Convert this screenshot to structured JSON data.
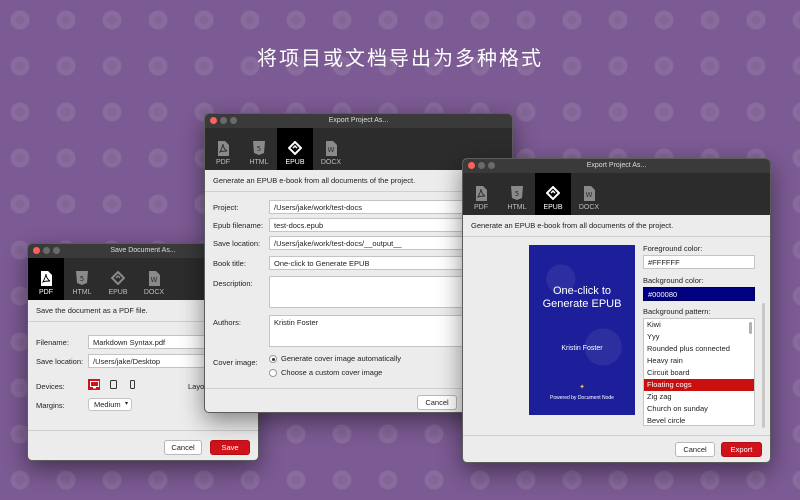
{
  "headline": "将项目或文档导出为多种格式",
  "pdf_window": {
    "title": "Save Document As...",
    "tabs": [
      {
        "label": "PDF",
        "icon": "pdf-file-icon"
      },
      {
        "label": "HTML",
        "icon": "html5-icon"
      },
      {
        "label": "EPUB",
        "icon": "epub-icon"
      },
      {
        "label": "DOCX",
        "icon": "word-doc-icon"
      }
    ],
    "description": "Save the document as a PDF file.",
    "filename_label": "Filename:",
    "filename_value": "Markdown Syntax.pdf",
    "save_location_label": "Save location:",
    "save_location_value": "/Users/jake/Desktop",
    "devices_label": "Devices:",
    "layout_label": "Layo",
    "margins_label": "Margins:",
    "margins_value": "Medium",
    "cancel": "Cancel",
    "save": "Save"
  },
  "epub_window": {
    "title": "Export Project As...",
    "tabs": [
      {
        "label": "PDF"
      },
      {
        "label": "HTML"
      },
      {
        "label": "EPUB"
      },
      {
        "label": "DOCX"
      }
    ],
    "description": "Generate an EPUB e-book from all documents of the project.",
    "project_label": "Project:",
    "project_value": "/Users/jake/work/test-docs",
    "epub_filename_label": "Epub filename:",
    "epub_filename_value": "test-docs.epub",
    "save_location_label": "Save location:",
    "save_location_value": "/Users/jake/work/test-docs/__output__",
    "book_title_label": "Book title:",
    "book_title_value": "One-click to Generate EPUB",
    "description_label": "Description:",
    "authors_label": "Authors:",
    "authors_value": "Kristin Foster",
    "cover_image_label": "Cover image:",
    "cover_option_auto": "Generate cover image automatically",
    "cover_option_custom": "Choose a custom cover image",
    "cancel": "Cancel"
  },
  "cover_window": {
    "title": "Export Project As...",
    "tabs": [
      {
        "label": "PDF"
      },
      {
        "label": "HTML"
      },
      {
        "label": "EPUB"
      },
      {
        "label": "DOCX"
      }
    ],
    "description": "Generate an EPUB e-book from all documents of the project.",
    "cover": {
      "title": "One-click to Generate EPUB",
      "author": "Kristin Foster",
      "powered": "Powered by Document Node"
    },
    "foreground_label": "Foreground color:",
    "foreground_value": "#FFFFFF",
    "background_label": "Background color:",
    "background_value": "#000080",
    "pattern_label": "Background pattern:",
    "patterns": [
      "Kiwi",
      "Yyy",
      "Rounded plus connected",
      "Heavy rain",
      "Circuit board",
      "Floating cogs",
      "Zig zag",
      "Church on sunday",
      "Bevel circle"
    ],
    "selected_pattern": "Floating cogs",
    "cancel": "Cancel",
    "export": "Export"
  },
  "colors": {
    "accent": "#d0121b",
    "background": "#7c5a93",
    "cover_bg": "#1d1f9a",
    "selected_bg_field": "#000080"
  }
}
